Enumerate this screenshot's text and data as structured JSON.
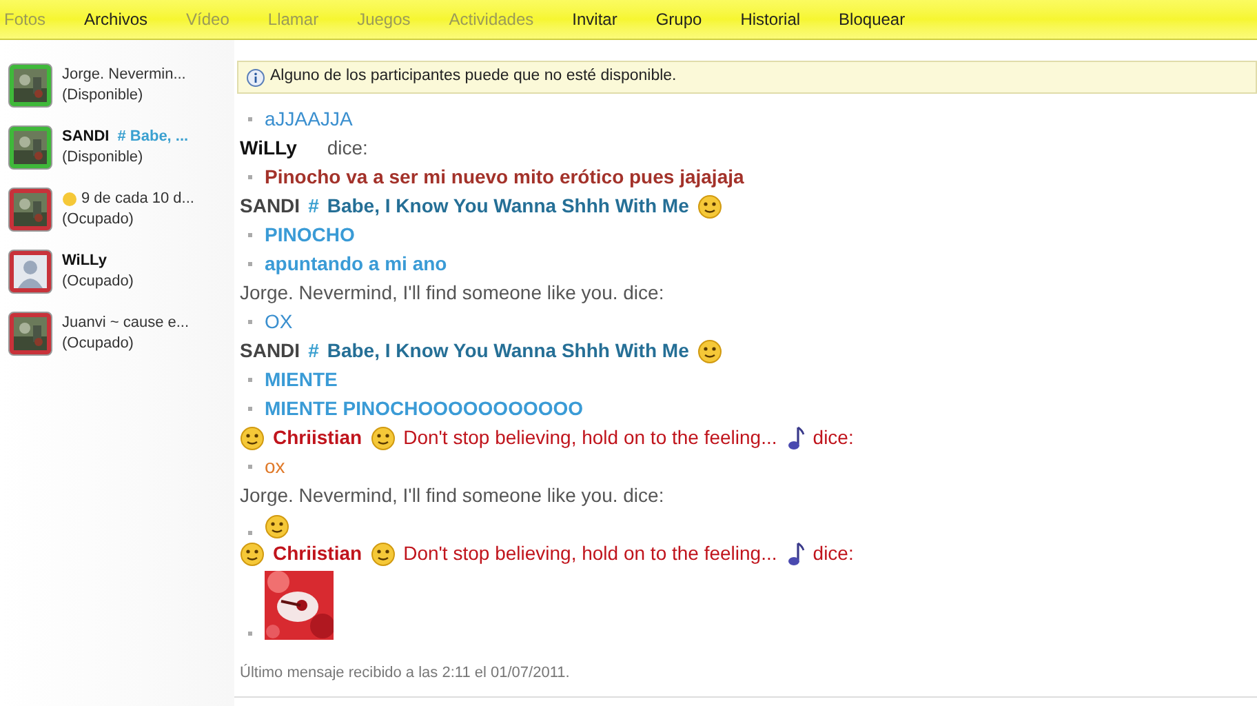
{
  "menu": [
    {
      "label": "Fotos",
      "disabled": true
    },
    {
      "label": "Archivos",
      "disabled": false
    },
    {
      "label": "Vídeo",
      "disabled": true
    },
    {
      "label": "Llamar",
      "disabled": true
    },
    {
      "label": "Juegos",
      "disabled": true
    },
    {
      "label": "Actividades",
      "disabled": true
    },
    {
      "label": "Invitar",
      "disabled": false
    },
    {
      "label": "Grupo",
      "disabled": false
    },
    {
      "label": "Historial",
      "disabled": false
    },
    {
      "label": "Bloquear",
      "disabled": false
    }
  ],
  "contacts": [
    {
      "name": "Jorge.  Nevermin...",
      "bold": false,
      "status": "(Disponible)",
      "color": "#3fb83a",
      "kind": "picture"
    },
    {
      "name": "SANDI",
      "bold": true,
      "tag": "# Babe, ...",
      "status": "(Disponible)",
      "color": "#3fb83a",
      "kind": "picture"
    },
    {
      "name": "9 de cada 10 d...",
      "bold": false,
      "emoticon": true,
      "status": "(Ocupado)",
      "color": "#c8323a",
      "kind": "picture"
    },
    {
      "name": "WiLLy",
      "bold": true,
      "status": "(Ocupado)",
      "color": "#c8323a",
      "kind": "silhouette"
    },
    {
      "name": "Juanvi  ~  cause e...",
      "bold": false,
      "status": "(Ocupado)",
      "color": "#c8323a",
      "kind": "picture"
    }
  ],
  "banner": "Alguno de los participantes puede que no esté disponible.",
  "chat": [
    {
      "kind": "message",
      "text": "aJJAAJJA",
      "color": "#3a8fcf",
      "bold": false
    },
    {
      "kind": "header",
      "parts": [
        {
          "kind": "text",
          "text": "WiLLy",
          "color": "#111111",
          "bold": true
        },
        {
          "kind": "text",
          "text": "dice:",
          "color": "#555555",
          "bold": false
        }
      ]
    },
    {
      "kind": "message",
      "text": "Pinocho va a ser mi nuevo mito erótico pues jajajaja",
      "color": "#a3322a",
      "bold": true
    },
    {
      "kind": "header",
      "parts": [
        {
          "kind": "text",
          "text": "SANDI",
          "color": "#444444",
          "bold": true
        },
        {
          "kind": "text",
          "text": "#",
          "color": "#3aa0d0",
          "bold": true
        },
        {
          "kind": "text",
          "text": "Babe, I Know You Wanna Shhh With Me",
          "color": "#256f96",
          "bold": true
        },
        {
          "kind": "emoticon"
        }
      ]
    },
    {
      "kind": "message",
      "text": "PINOCHO",
      "color": "#3a9bd6",
      "bold": true
    },
    {
      "kind": "message",
      "text": "apuntando a mi ano",
      "color": "#3a9bd6",
      "bold": true
    },
    {
      "kind": "header",
      "parts": [
        {
          "kind": "text",
          "text": "Jorge.  Nevermind, I'll find someone like you. dice:",
          "color": "#555555",
          "bold": false
        }
      ]
    },
    {
      "kind": "message",
      "text": "OX",
      "color": "#3a8fcf",
      "bold": false
    },
    {
      "kind": "header",
      "parts": [
        {
          "kind": "text",
          "text": "SANDI",
          "color": "#444444",
          "bold": true
        },
        {
          "kind": "text",
          "text": "#",
          "color": "#3aa0d0",
          "bold": true
        },
        {
          "kind": "text",
          "text": "Babe, I Know You Wanna Shhh With Me",
          "color": "#256f96",
          "bold": true
        },
        {
          "kind": "emoticon"
        }
      ]
    },
    {
      "kind": "message",
      "text": "MIENTE",
      "color": "#3a9bd6",
      "bold": true
    },
    {
      "kind": "message",
      "text": "MIENTE PINOCHOOOOOOOOOOO",
      "color": "#3a9bd6",
      "bold": true
    },
    {
      "kind": "header",
      "parts": [
        {
          "kind": "emoticon"
        },
        {
          "kind": "text",
          "text": "Chriistian",
          "color": "#c0141c",
          "bold": true
        },
        {
          "kind": "emoticon"
        },
        {
          "kind": "text",
          "text": "Don't stop believing, hold on to the feeling...",
          "color": "#c0141c",
          "bold": false
        },
        {
          "kind": "note"
        },
        {
          "kind": "text",
          "text": "dice:",
          "color": "#c0141c",
          "bold": false
        }
      ]
    },
    {
      "kind": "message",
      "text": "ox",
      "color": "#e07a2a",
      "bold": false
    },
    {
      "kind": "header",
      "parts": [
        {
          "kind": "text",
          "text": "Jorge.  Nevermind, I'll find someone like you. dice:",
          "color": "#555555",
          "bold": false
        }
      ]
    },
    {
      "kind": "emoticon"
    },
    {
      "kind": "header",
      "parts": [
        {
          "kind": "emoticon"
        },
        {
          "kind": "text",
          "text": "Chriistian",
          "color": "#c0141c",
          "bold": true
        },
        {
          "kind": "emoticon"
        },
        {
          "kind": "text",
          "text": "Don't stop believing, hold on to the feeling...",
          "color": "#c0141c",
          "bold": false
        },
        {
          "kind": "note"
        },
        {
          "kind": "text",
          "text": "dice:",
          "color": "#c0141c",
          "bold": false
        }
      ]
    },
    {
      "kind": "picture"
    }
  ],
  "footer": "Último mensaje recibido a las 2:11 el 01/07/2011."
}
